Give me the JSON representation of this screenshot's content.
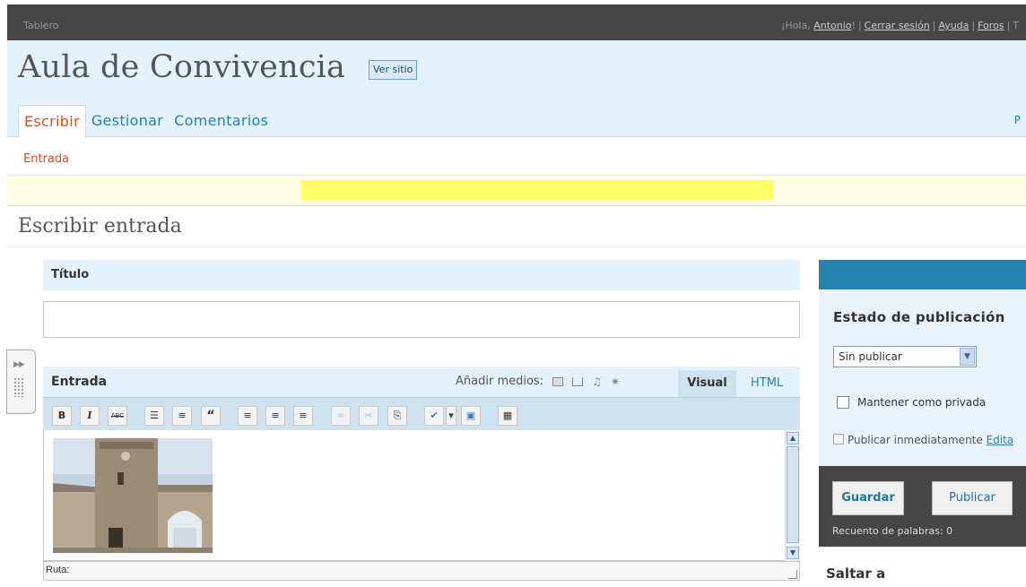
{
  "topbar": {
    "dashboard": "Tablero",
    "greeting": "¡Hola, ",
    "user": "Antonio",
    "greeting_end": "!",
    "logout": "Cerrar sesión",
    "help": "Ayuda",
    "forums": "Foros",
    "truncated": "T"
  },
  "header": {
    "site_title": "Aula de Convivencia",
    "view_site": "Ver sitio",
    "tabs": [
      {
        "label": "Escribir",
        "active": true
      },
      {
        "label": "Gestionar",
        "active": false
      },
      {
        "label": "Comentarios",
        "active": false
      }
    ],
    "right_truncated": "P"
  },
  "subnav": {
    "item": "Entrada"
  },
  "page": {
    "heading": "Escribir entrada"
  },
  "title_box": {
    "label": "Título",
    "value": ""
  },
  "editor": {
    "label": "Entrada",
    "add_media": "Añadir medios:",
    "tab_visual": "Visual",
    "tab_html": "HTML",
    "toolbar": [
      {
        "name": "bold-button",
        "glyph": "B",
        "enabled": true
      },
      {
        "name": "italic-button",
        "glyph": "I",
        "enabled": true
      },
      {
        "name": "strikethrough-button",
        "glyph": "ABC",
        "enabled": true
      },
      {
        "name": "bullet-list-button",
        "glyph": "☰",
        "enabled": true
      },
      {
        "name": "numbered-list-button",
        "glyph": "≡",
        "enabled": true
      },
      {
        "name": "blockquote-button",
        "glyph": "“",
        "enabled": true
      },
      {
        "name": "align-left-button",
        "glyph": "≡",
        "enabled": true
      },
      {
        "name": "align-center-button",
        "glyph": "≡",
        "enabled": true
      },
      {
        "name": "align-right-button",
        "glyph": "≡",
        "enabled": true
      },
      {
        "name": "link-button",
        "glyph": "∞",
        "enabled": false
      },
      {
        "name": "unlink-button",
        "glyph": "✂",
        "enabled": false
      },
      {
        "name": "more-button",
        "glyph": "⎘",
        "enabled": true
      },
      {
        "name": "spellcheck-button",
        "glyph": "✔",
        "enabled": true
      },
      {
        "name": "spellcheck-dropdown",
        "glyph": "▾",
        "enabled": true
      },
      {
        "name": "fullscreen-button",
        "glyph": "▣",
        "enabled": true
      },
      {
        "name": "kitchen-sink-button",
        "glyph": "▦",
        "enabled": true
      }
    ],
    "path_label": "Ruta:"
  },
  "sidebar": {
    "publish_title": "Estado de publicación",
    "status_selected": "Sin publicar",
    "private_label": "Mantener como privada",
    "publish_now": "Publicar inmediatamente",
    "edit_link": "Edita",
    "save_button": "Guardar",
    "publish_button": "Publicar",
    "word_count": "Recuento de palabras: 0",
    "jump_to": "Saltar a"
  },
  "colors": {
    "accent_blue": "#2583ad",
    "active_orange": "#d54e21",
    "header_bg": "#e4f2fd",
    "dark_bar": "#464646"
  }
}
